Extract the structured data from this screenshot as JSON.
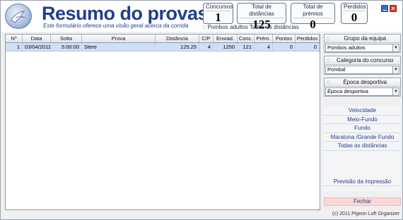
{
  "header": {
    "title": "Resumo do provas",
    "subtitle": "Este formulário oferece uma visão geral acerca da corrida",
    "filter_caption": "Pombos adultos Todas as distâncias"
  },
  "stats": {
    "concursos": {
      "label": "Concursos",
      "value": "1"
    },
    "total_distancias": {
      "label": "Total de distâncias",
      "value": "125"
    },
    "total_premios": {
      "label": "Total de prémios",
      "value": "0"
    },
    "perdidos": {
      "label": "Perdidos",
      "value": "0"
    }
  },
  "grid": {
    "columns": [
      "Nº",
      "Data",
      "Solta",
      "Prova",
      "Distância",
      "C/P",
      "Enviad.",
      "Conc.",
      "Prém.",
      "Pontos",
      "Perdidos"
    ],
    "rows": [
      {
        "n": "1",
        "data": "03/04/2011",
        "solta": "5:00:00",
        "prova": "Stere",
        "distancia": "125.25",
        "cp": "4",
        "enviad": "1250",
        "conc": "121",
        "prem": "4",
        "pontos": "0",
        "perdidos": "0"
      }
    ]
  },
  "side": {
    "grupo": {
      "title": "Grupo da equipa",
      "value": "Pombos adultos"
    },
    "categoria": {
      "title": "Categoria do concurso",
      "value": "Pombal"
    },
    "epoca": {
      "title": "Época desportiva",
      "value": "Época desportiva"
    },
    "links": [
      "Velocidade",
      "Meio-Fundo",
      "Fundo",
      "Maratona /Grande Fundo",
      "Todas as distâncias"
    ],
    "print_preview": "Previsão da impressão",
    "close": "Fechar"
  },
  "footer": {
    "copyright": "(c) 2011 Pigeon Loft Organizer"
  },
  "colors": {
    "accent": "#1f3f8f",
    "selected_row": "#cfe0f5",
    "close_button": "#fbd8d8"
  },
  "icons": {
    "logo": "pigeon-logo-icon",
    "minimize": "minimize-icon",
    "close": "close-icon"
  }
}
